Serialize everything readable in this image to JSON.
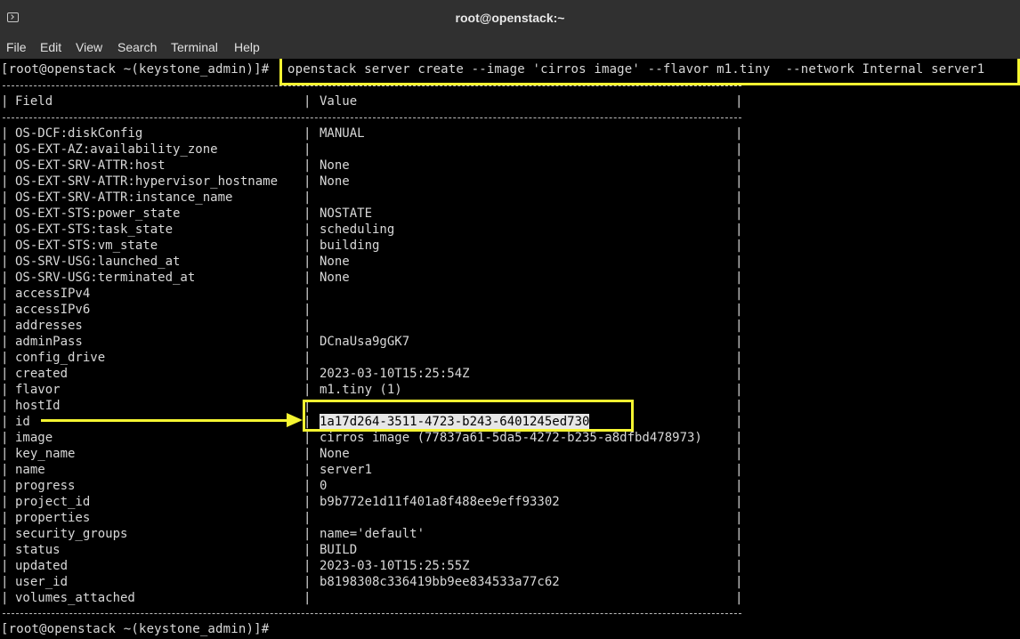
{
  "window": {
    "title": "root@openstack:~"
  },
  "menu": {
    "items": [
      "File",
      "Edit",
      "View",
      "Search",
      "Terminal",
      "Help"
    ]
  },
  "terminal": {
    "prompt": "[root@openstack ~(keystone_admin)]#",
    "command": "openstack server create --image 'cirros image' --flavor m1.tiny  --network Internal server1",
    "header": {
      "field": "Field",
      "value": "Value"
    },
    "rows": [
      {
        "field": "OS-DCF:diskConfig",
        "value": "MANUAL"
      },
      {
        "field": "OS-EXT-AZ:availability_zone",
        "value": ""
      },
      {
        "field": "OS-EXT-SRV-ATTR:host",
        "value": "None"
      },
      {
        "field": "OS-EXT-SRV-ATTR:hypervisor_hostname",
        "value": "None"
      },
      {
        "field": "OS-EXT-SRV-ATTR:instance_name",
        "value": ""
      },
      {
        "field": "OS-EXT-STS:power_state",
        "value": "NOSTATE"
      },
      {
        "field": "OS-EXT-STS:task_state",
        "value": "scheduling"
      },
      {
        "field": "OS-EXT-STS:vm_state",
        "value": "building"
      },
      {
        "field": "OS-SRV-USG:launched_at",
        "value": "None"
      },
      {
        "field": "OS-SRV-USG:terminated_at",
        "value": "None"
      },
      {
        "field": "accessIPv4",
        "value": ""
      },
      {
        "field": "accessIPv6",
        "value": ""
      },
      {
        "field": "addresses",
        "value": ""
      },
      {
        "field": "adminPass",
        "value": "DCnaUsa9gGK7"
      },
      {
        "field": "config_drive",
        "value": ""
      },
      {
        "field": "created",
        "value": "2023-03-10T15:25:54Z"
      },
      {
        "field": "flavor",
        "value": "m1.tiny (1)"
      },
      {
        "field": "hostId",
        "value": ""
      },
      {
        "field": "id",
        "value": "1a17d264-3511-4723-b243-6401245ed730"
      },
      {
        "field": "image",
        "value": "cirros image (77837a61-5da5-4272-b235-a8dfbd478973)"
      },
      {
        "field": "key_name",
        "value": "None"
      },
      {
        "field": "name",
        "value": "server1"
      },
      {
        "field": "progress",
        "value": "0"
      },
      {
        "field": "project_id",
        "value": "b9b772e1d11f401a8f488ee9eff93302"
      },
      {
        "field": "properties",
        "value": ""
      },
      {
        "field": "security_groups",
        "value": "name='default'"
      },
      {
        "field": "status",
        "value": "BUILD"
      },
      {
        "field": "updated",
        "value": "2023-03-10T15:25:55Z"
      },
      {
        "field": "user_id",
        "value": "b8198308c336419bb9ee834533a77c62"
      },
      {
        "field": "volumes_attached",
        "value": ""
      }
    ],
    "final_prompt": "[root@openstack ~(keystone_admin)]#"
  },
  "annotation_color": "#f5f531"
}
